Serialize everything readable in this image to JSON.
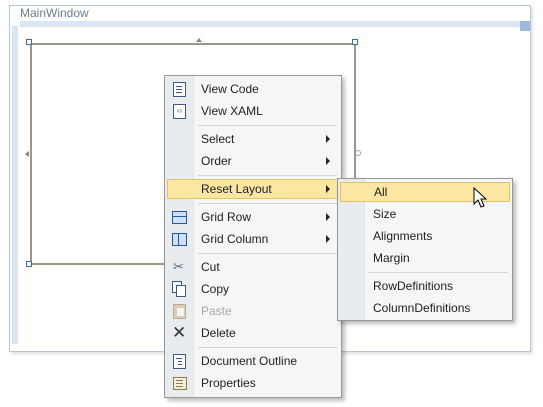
{
  "window": {
    "title": "MainWindow"
  },
  "context_menu": {
    "items": [
      {
        "label": "View Code",
        "icon": "view-code-icon"
      },
      {
        "label": "View XAML",
        "icon": "view-xaml-icon"
      },
      {
        "label": "Select",
        "submenu": true
      },
      {
        "label": "Order",
        "submenu": true
      },
      {
        "label": "Reset Layout",
        "submenu": true,
        "highlighted": true
      },
      {
        "label": "Grid Row",
        "submenu": true,
        "icon": "grid-row-icon"
      },
      {
        "label": "Grid Column",
        "submenu": true,
        "icon": "grid-column-icon"
      },
      {
        "label": "Cut",
        "icon": "scissors-icon"
      },
      {
        "label": "Copy",
        "icon": "copy-icon"
      },
      {
        "label": "Paste",
        "icon": "paste-icon",
        "disabled": true
      },
      {
        "label": "Delete",
        "icon": "delete-x-icon"
      },
      {
        "label": "Document Outline",
        "icon": "document-outline-icon"
      },
      {
        "label": "Properties",
        "icon": "properties-icon"
      }
    ]
  },
  "reset_layout_submenu": {
    "items": [
      {
        "label": "All",
        "highlighted": true
      },
      {
        "label": "Size"
      },
      {
        "label": "Alignments"
      },
      {
        "label": "Margin"
      },
      {
        "label": "RowDefinitions"
      },
      {
        "label": "ColumnDefinitions"
      }
    ]
  },
  "colors": {
    "highlight": "#fbe6a2",
    "highlight_border": "#e5c365",
    "menu_bg": "#f5f6f8",
    "grid_border": "#9e9587"
  }
}
